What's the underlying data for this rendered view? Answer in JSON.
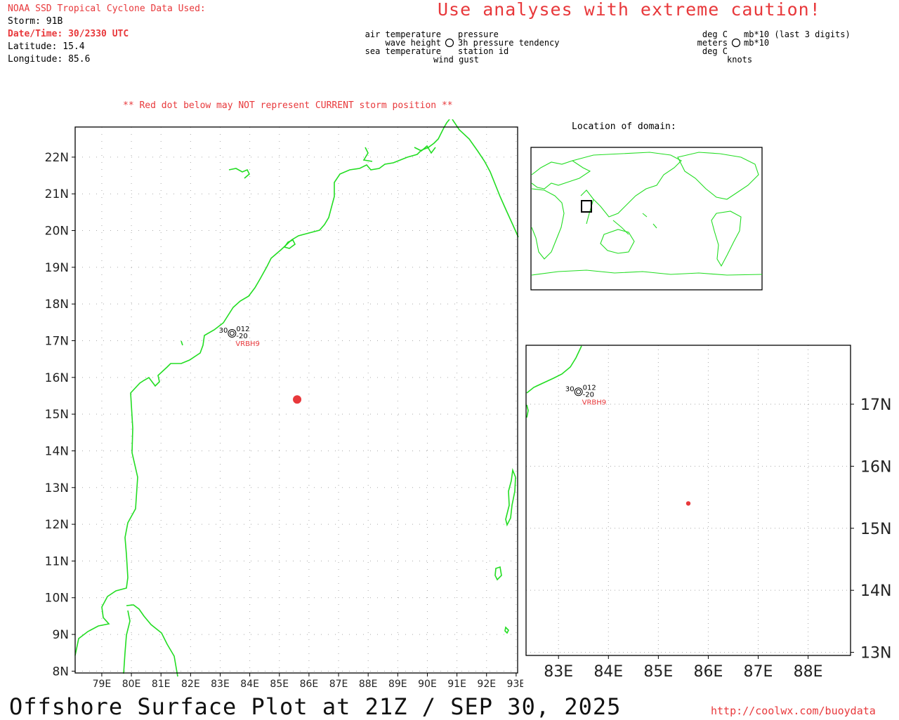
{
  "info": {
    "source": "NOAA SSD Tropical Cyclone Data Used:",
    "storm": "Storm: 91B",
    "datetime": "Date/Time: 30/2330 UTC",
    "latitude": "Latitude: 15.4",
    "longitude": "Longitude: 85.6"
  },
  "caution": "Use analyses with extreme caution!",
  "legend_left": {
    "air_temperature": "air temperature",
    "wave_height": "wave height",
    "sea_temperature": "sea temperature",
    "pressure": "pressure",
    "pressure_tendency": "3h pressure tendency",
    "station_id": "station id",
    "wind_gust": "wind gust"
  },
  "legend_right": {
    "deg_c_1": "deg C",
    "meters": "meters",
    "deg_c_2": "deg C",
    "mb_last3": "mb*10 (last 3 digits)",
    "mb": "mb*10",
    "knots": "knots"
  },
  "red_dot_note": "** Red dot below may NOT represent CURRENT storm position **",
  "location_label": "Location of domain:",
  "storm_position": {
    "lat": 15.4,
    "lon": 85.6
  },
  "station": {
    "id": "VRBH9",
    "air_temp": "30",
    "pressure": "012",
    "tendency": "-20",
    "lat": 17.2,
    "lon": 83.4
  },
  "main_map": {
    "lat_labels": [
      "22N",
      "21N",
      "20N",
      "19N",
      "18N",
      "17N",
      "16N",
      "15N",
      "14N",
      "13N",
      "12N",
      "11N",
      "10N",
      "9N",
      "8N"
    ],
    "lon_labels": [
      "79E",
      "80E",
      "81E",
      "82E",
      "83E",
      "84E",
      "85E",
      "86E",
      "87E",
      "88E",
      "89E",
      "90E",
      "91E",
      "92E",
      "93E"
    ]
  },
  "zoom_map": {
    "lat_labels": [
      "17N",
      "16N",
      "15N",
      "14N",
      "13N"
    ],
    "lon_labels": [
      "83E",
      "84E",
      "85E",
      "86E",
      "87E",
      "88E"
    ]
  },
  "footer": {
    "title": "Offshore Surface Plot at 21Z / SEP 30, 2025",
    "url": "http://coolwx.com/buoydata"
  },
  "colors": {
    "coast": "#22dd22",
    "red": "#e8383b",
    "grid": "#aaaaaa"
  }
}
